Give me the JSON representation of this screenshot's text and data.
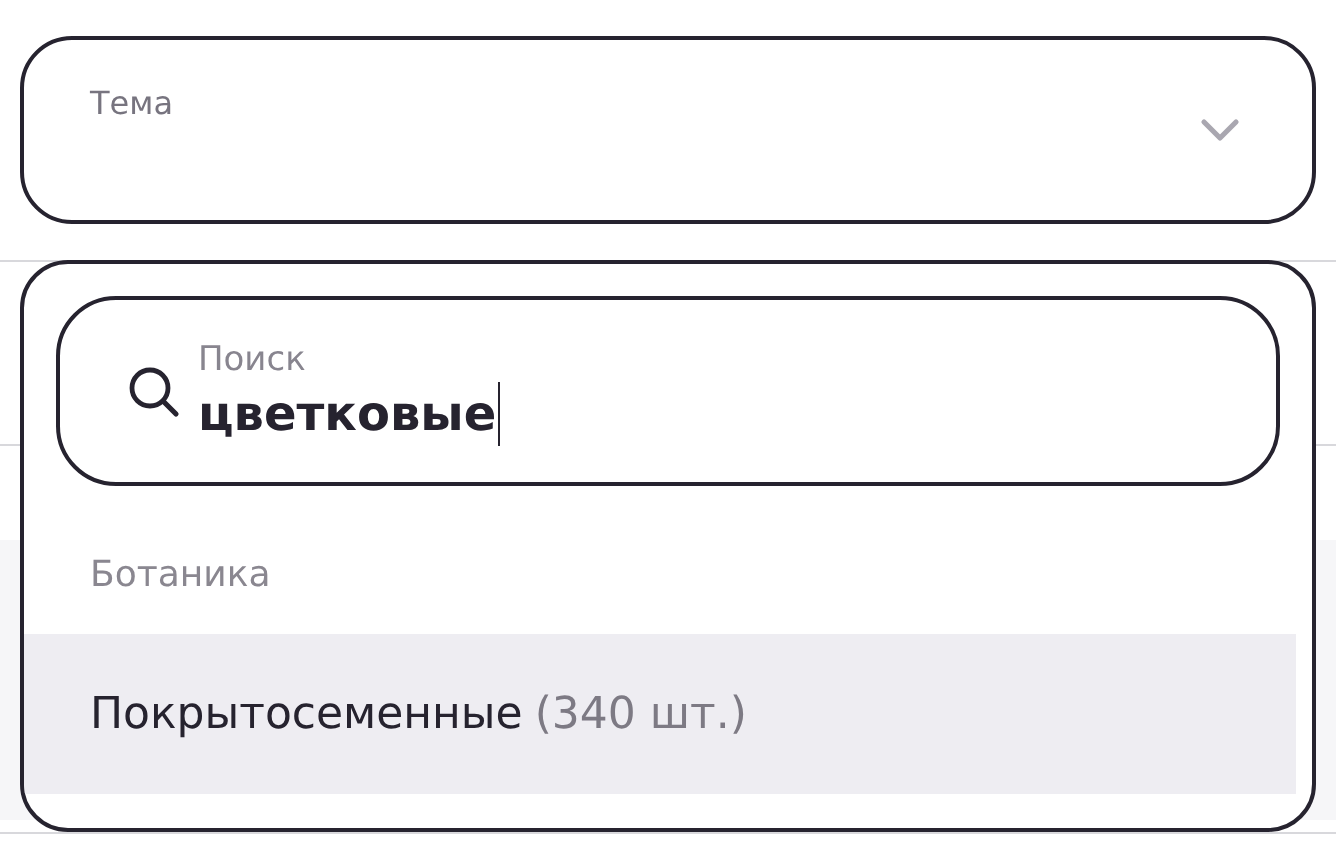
{
  "select": {
    "label": "Тема",
    "expanded": true
  },
  "search": {
    "label": "Поиск",
    "value": "цветковые"
  },
  "groups": [
    {
      "title": "Ботаника",
      "options": [
        {
          "label": "Покрытосеменные",
          "count": "(340 шт.)",
          "selected": true
        }
      ]
    }
  ]
}
